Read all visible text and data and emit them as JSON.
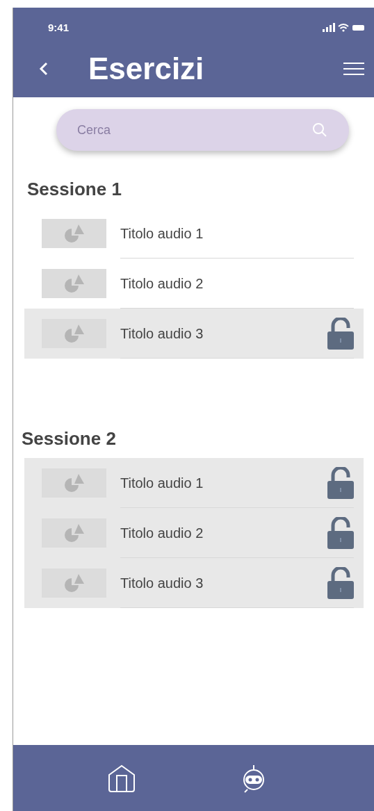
{
  "status_bar": {
    "time": "9:41"
  },
  "header": {
    "title": "Esercizi"
  },
  "search": {
    "placeholder": "Cerca"
  },
  "sessions": [
    {
      "title": "Sessione 1",
      "items": [
        {
          "title": "Titolo audio 1",
          "kind": "plain"
        },
        {
          "title": "Titolo audio 2",
          "kind": "plain"
        },
        {
          "title": "Titolo audio 3",
          "kind": "padlock"
        }
      ]
    },
    {
      "title": "Sessione 2",
      "items": [
        {
          "title": "Titolo audio 1",
          "kind": "padlock"
        },
        {
          "title": "Titolo audio 2",
          "kind": "padlock"
        },
        {
          "title": "Titolo audio 3",
          "kind": "padlock"
        }
      ]
    }
  ],
  "bottom_nav": [
    {
      "kind": "home"
    },
    {
      "kind": "robot"
    }
  ]
}
